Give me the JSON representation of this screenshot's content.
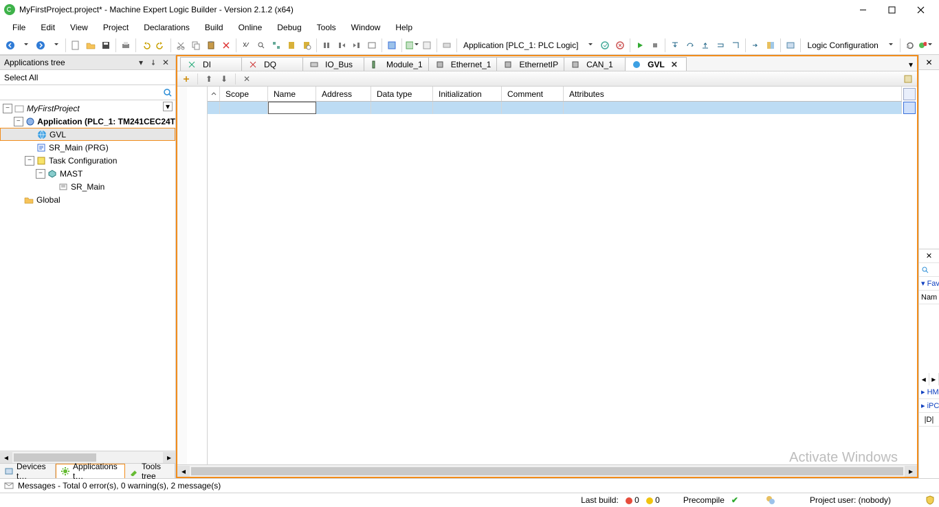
{
  "window": {
    "title": "MyFirstProject.project* - Machine Expert Logic Builder - Version 2.1.2 (x64)"
  },
  "menu": [
    "File",
    "Edit",
    "View",
    "Project",
    "Declarations",
    "Build",
    "Online",
    "Debug",
    "Tools",
    "Window",
    "Help"
  ],
  "toolbar": {
    "app_combo": "Application [PLC_1: PLC Logic]",
    "right_combo": "Logic Configuration"
  },
  "left_panel": {
    "title": "Applications tree",
    "select_all": "Select All",
    "tabs": {
      "devices": "Devices t…",
      "applications": "Applications t…",
      "tools": "Tools tree"
    }
  },
  "tree": {
    "root": "MyFirstProject",
    "app": "Application (PLC_1: TM241CEC24T",
    "gvl": "GVL",
    "sr_main_prg": "SR_Main (PRG)",
    "task_cfg": "Task Configuration",
    "mast": "MAST",
    "sr_main": "SR_Main",
    "global": "Global"
  },
  "doc_tabs": [
    "DI",
    "DQ",
    "IO_Bus",
    "Module_1",
    "Ethernet_1",
    "EthernetIP",
    "CAN_1",
    "GVL"
  ],
  "grid": {
    "headers": [
      "Scope",
      "Name",
      "Address",
      "Data type",
      "Initialization",
      "Comment",
      "Attributes"
    ]
  },
  "right": {
    "fav": "▾ Fav",
    "nam": "Nam",
    "hm": "▸ HM",
    "ipc": "▸ iPC",
    "d": "|D|"
  },
  "messages": {
    "text": "Messages - Total 0 error(s), 0 warning(s), 2 message(s)"
  },
  "status": {
    "last_build_label": "Last build:",
    "err": "0",
    "warn": "0",
    "precompile": "Precompile",
    "project_user": "Project user: (nobody)"
  },
  "watermark": {
    "line1": "Activate Windows"
  }
}
